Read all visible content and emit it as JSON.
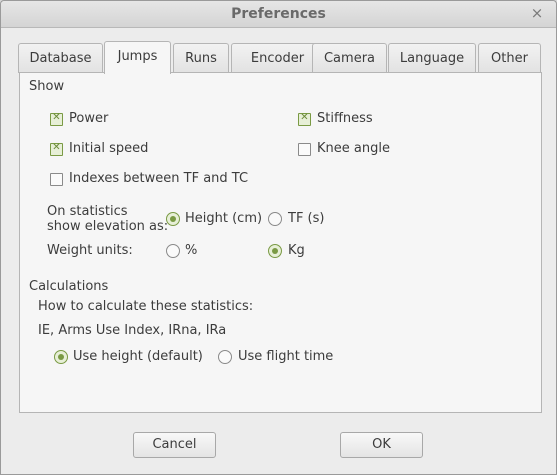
{
  "window": {
    "title": "Preferences",
    "close_glyph": "×"
  },
  "tabs": [
    {
      "label": "Database"
    },
    {
      "label": "Jumps",
      "active": true
    },
    {
      "label": "Runs"
    },
    {
      "label": "Encoder"
    },
    {
      "label": "Camera"
    },
    {
      "label": "Language"
    },
    {
      "label": "Other"
    }
  ],
  "show": {
    "heading": "Show",
    "power": {
      "label": "Power",
      "checked": true
    },
    "stiffness": {
      "label": "Stiffness",
      "checked": true
    },
    "initial_speed": {
      "label": "Initial speed",
      "checked": true
    },
    "knee_angle": {
      "label": "Knee angle",
      "checked": false
    },
    "indexes_tf_tc": {
      "label": "Indexes between TF and TC",
      "checked": false
    }
  },
  "elevation": {
    "label_line1": "On statistics",
    "label_line2": "show elevation as:",
    "height": {
      "label": "Height (cm)",
      "selected": true
    },
    "tf": {
      "label": "TF (s)",
      "selected": false
    }
  },
  "weight": {
    "label": "Weight units:",
    "percent": {
      "label": "%",
      "selected": false
    },
    "kg": {
      "label": "Kg",
      "selected": true
    }
  },
  "calculations": {
    "heading": "Calculations",
    "question": "How to calculate these statistics:",
    "stats": "IE, Arms Use Index, IRna, IRa",
    "use_height": {
      "label": "Use height  (default)",
      "selected": true
    },
    "use_flight_time": {
      "label": "Use flight time",
      "selected": false
    }
  },
  "buttons": {
    "cancel": "Cancel",
    "ok": "OK"
  },
  "colors": {
    "accent": "#7a9a44",
    "window_bg": "#ececec",
    "panel_bg": "#f6f6f6"
  }
}
